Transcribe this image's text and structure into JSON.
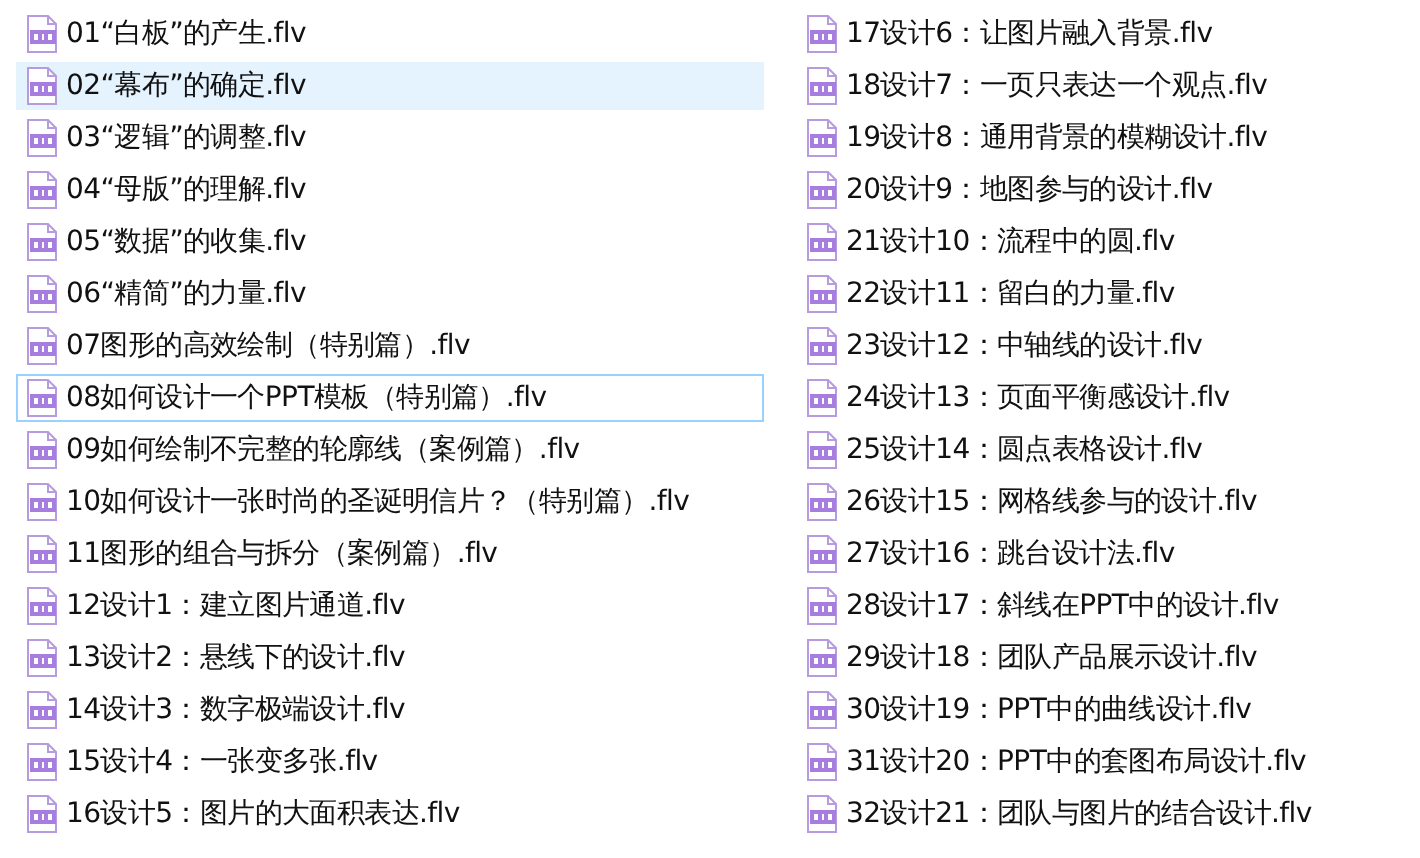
{
  "files": [
    {
      "name": "01“白板”的产生.flv",
      "hovered": false,
      "focused": false
    },
    {
      "name": "02“幕布”的确定.flv",
      "hovered": true,
      "focused": false
    },
    {
      "name": "03“逻辑”的调整.flv",
      "hovered": false,
      "focused": false
    },
    {
      "name": "04“母版”的理解.flv",
      "hovered": false,
      "focused": false
    },
    {
      "name": "05“数据”的收集.flv",
      "hovered": false,
      "focused": false
    },
    {
      "name": "06“精简”的力量.flv",
      "hovered": false,
      "focused": false
    },
    {
      "name": "07图形的高效绘制（特别篇）.flv",
      "hovered": false,
      "focused": false
    },
    {
      "name": "08如何设计一个PPT模板（特别篇）.flv",
      "hovered": false,
      "focused": true
    },
    {
      "name": "09如何绘制不完整的轮廓线（案例篇）.flv",
      "hovered": false,
      "focused": false
    },
    {
      "name": "10如何设计一张时尚的圣诞明信片？（特别篇）.flv",
      "hovered": false,
      "focused": false
    },
    {
      "name": "11图形的组合与拆分（案例篇）.flv",
      "hovered": false,
      "focused": false
    },
    {
      "name": "12设计1：建立图片通道.flv",
      "hovered": false,
      "focused": false
    },
    {
      "name": "13设计2：悬线下的设计.flv",
      "hovered": false,
      "focused": false
    },
    {
      "name": "14设计3：数字极端设计.flv",
      "hovered": false,
      "focused": false
    },
    {
      "name": "15设计4：一张变多张.flv",
      "hovered": false,
      "focused": false
    },
    {
      "name": "16设计5：图片的大面积表达.flv",
      "hovered": false,
      "focused": false
    },
    {
      "name": "17设计6：让图片融入背景.flv",
      "hovered": false,
      "focused": false
    },
    {
      "name": "18设计7：一页只表达一个观点.flv",
      "hovered": false,
      "focused": false
    },
    {
      "name": "19设计8：通用背景的模糊设计.flv",
      "hovered": false,
      "focused": false
    },
    {
      "name": "20设计9：地图参与的设计.flv",
      "hovered": false,
      "focused": false
    },
    {
      "name": "21设计10：流程中的圆.flv",
      "hovered": false,
      "focused": false
    },
    {
      "name": "22设计11：留白的力量.flv",
      "hovered": false,
      "focused": false
    },
    {
      "name": "23设计12：中轴线的设计.flv",
      "hovered": false,
      "focused": false
    },
    {
      "name": "24设计13：页面平衡感设计.flv",
      "hovered": false,
      "focused": false
    },
    {
      "name": "25设计14：圆点表格设计.flv",
      "hovered": false,
      "focused": false
    },
    {
      "name": "26设计15：网格线参与的设计.flv",
      "hovered": false,
      "focused": false
    },
    {
      "name": "27设计16：跳台设计法.flv",
      "hovered": false,
      "focused": false
    },
    {
      "name": "28设计17：斜线在PPT中的设计.flv",
      "hovered": false,
      "focused": false
    },
    {
      "name": "29设计18：团队产品展示设计.flv",
      "hovered": false,
      "focused": false
    },
    {
      "name": "30设计19：PPT中的曲线设计.flv",
      "hovered": false,
      "focused": false
    },
    {
      "name": "31设计20：PPT中的套图布局设计.flv",
      "hovered": false,
      "focused": false
    },
    {
      "name": "32设计21：团队与图片的结合设计.flv",
      "hovered": false,
      "focused": false
    }
  ]
}
